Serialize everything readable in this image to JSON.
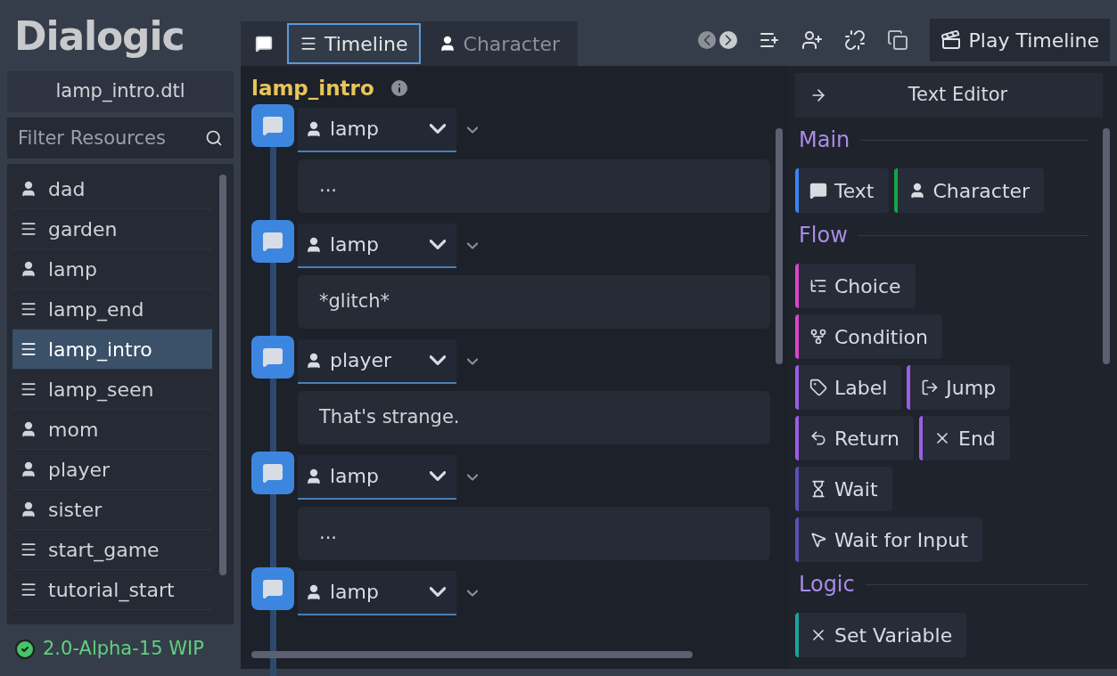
{
  "logo": "Dialogic",
  "current_file": "lamp_intro.dtl",
  "filter": {
    "placeholder": "Filter Resources"
  },
  "resources": [
    {
      "name": "dad",
      "kind": "character",
      "selected": false
    },
    {
      "name": "garden",
      "kind": "timeline",
      "selected": false
    },
    {
      "name": "lamp",
      "kind": "character",
      "selected": false
    },
    {
      "name": "lamp_end",
      "kind": "timeline",
      "selected": false
    },
    {
      "name": "lamp_intro",
      "kind": "timeline",
      "selected": true
    },
    {
      "name": "lamp_seen",
      "kind": "timeline",
      "selected": false
    },
    {
      "name": "mom",
      "kind": "character",
      "selected": false
    },
    {
      "name": "player",
      "kind": "character",
      "selected": false
    },
    {
      "name": "sister",
      "kind": "character",
      "selected": false
    },
    {
      "name": "start_game",
      "kind": "timeline",
      "selected": false
    },
    {
      "name": "tutorial_start",
      "kind": "timeline",
      "selected": false
    }
  ],
  "version": "2.0-Alpha-15 WIP",
  "tabs": [
    {
      "label": "Timeline",
      "kind": "timeline",
      "selected": true
    },
    {
      "label": "Character",
      "kind": "character",
      "selected": false
    }
  ],
  "play_button": "Play Timeline",
  "timeline_title": "lamp_intro",
  "events": [
    {
      "character": "lamp",
      "text": "..."
    },
    {
      "character": "lamp",
      "text": "*glitch*"
    },
    {
      "character": "player",
      "text": "That's strange."
    },
    {
      "character": "lamp",
      "text": "..."
    },
    {
      "character": "lamp"
    }
  ],
  "text_editor_button": "Text Editor",
  "sections": [
    {
      "title": "Main",
      "rows": [
        [
          {
            "label": "Text",
            "kind": "text",
            "color": "#3b82f6"
          },
          {
            "label": "Character",
            "kind": "character",
            "color": "#16a34a"
          }
        ]
      ]
    },
    {
      "title": "Flow",
      "rows": [
        [
          {
            "label": "Choice",
            "kind": "choice",
            "color": "#d946c8"
          }
        ],
        [
          {
            "label": "Condition",
            "kind": "condition",
            "color": "#d946c8"
          }
        ],
        [
          {
            "label": "Label",
            "kind": "label",
            "color": "#9b5de5"
          },
          {
            "label": "Jump",
            "kind": "jump",
            "color": "#9b5de5"
          }
        ],
        [
          {
            "label": "Return",
            "kind": "return",
            "color": "#9b5de5"
          },
          {
            "label": "End",
            "kind": "end",
            "color": "#9b5de5"
          }
        ],
        [
          {
            "label": "Wait",
            "kind": "wait",
            "color": "#5b4fb8"
          }
        ],
        [
          {
            "label": "Wait for Input",
            "kind": "mouse",
            "color": "#5b4fb8"
          }
        ]
      ]
    },
    {
      "title": "Logic",
      "rows": [
        [
          {
            "label": "Set Variable",
            "kind": "variable",
            "color": "#1ba39c"
          }
        ]
      ]
    }
  ]
}
